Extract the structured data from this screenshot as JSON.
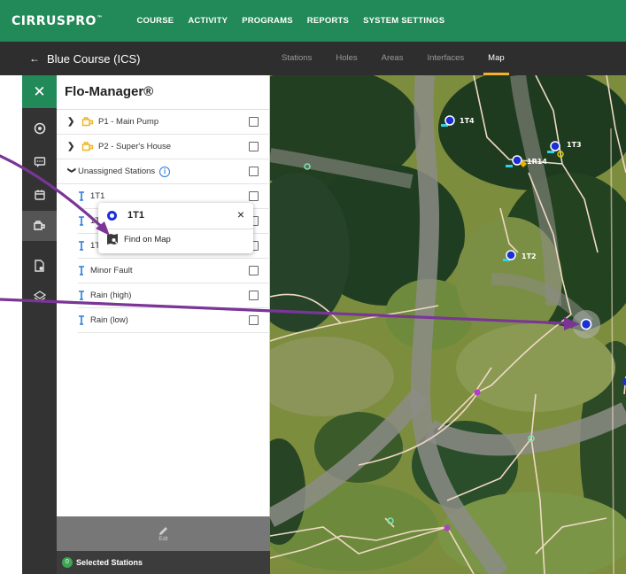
{
  "brand": {
    "name_part1": "CIRRUS",
    "name_part2": "PRO",
    "tm": "™"
  },
  "nav": {
    "items": [
      "COURSE",
      "ACTIVITY",
      "PROGRAMS",
      "REPORTS",
      "SYSTEM SETTINGS"
    ]
  },
  "subbar": {
    "back_label": "Blue Course (ICS)",
    "tabs": [
      {
        "label": "Stations",
        "active": false
      },
      {
        "label": "Holes",
        "active": false
      },
      {
        "label": "Areas",
        "active": false
      },
      {
        "label": "Interfaces",
        "active": false
      },
      {
        "label": "Map",
        "active": true
      }
    ]
  },
  "panel": {
    "title": "Flo-Manager®",
    "pumps": [
      {
        "label": "P1 - Main Pump"
      },
      {
        "label": "P2 - Super's House"
      }
    ],
    "unassigned": {
      "label": "Unassigned Stations"
    },
    "stations": [
      {
        "label": "1T1"
      },
      {
        "label": "1T2"
      },
      {
        "label": "1T3"
      },
      {
        "label": "Minor Fault"
      },
      {
        "label": "Rain (high)"
      },
      {
        "label": "Rain (low)"
      }
    ],
    "edit_label": "Edit",
    "selected_count": "0",
    "selected_label": "Selected Stations"
  },
  "popup": {
    "title": "1T1",
    "close_glyph": "×",
    "action_label": "Find on Map"
  },
  "map": {
    "markers": [
      {
        "label": "1T4"
      },
      {
        "label": "1T3"
      },
      {
        "label": "1R14"
      },
      {
        "label": "1T2"
      }
    ]
  },
  "colors": {
    "brand_green": "#218a58",
    "dark_bar": "#2e2e2e",
    "active_tab": "#f3b228",
    "pump_icon": "#f0b323",
    "station_icon": "#2b7bd9",
    "annotation_arrow": "#7a3596",
    "marker_blue": "#1a2fd6"
  },
  "icons": {
    "close": "close-icon",
    "rail": [
      "target-icon",
      "chat-icon",
      "calendar-icon",
      "pump-icon",
      "document-icon",
      "layers-icon"
    ],
    "pump": "pump-icon",
    "station": "sprinkler-icon",
    "find_on_map": "map-search-icon",
    "edit": "pencil-icon"
  }
}
